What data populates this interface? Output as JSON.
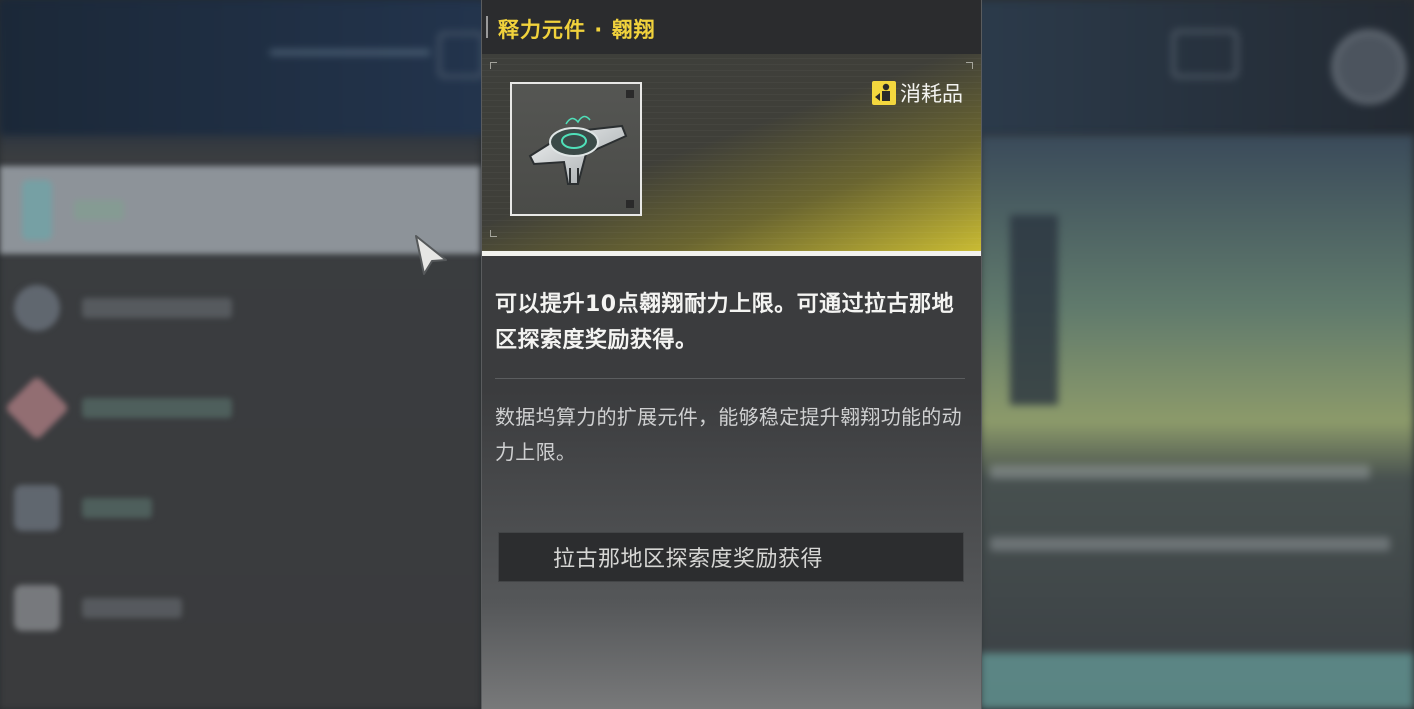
{
  "item": {
    "name": "释力元件 · 翱翔",
    "type_label": "消耗品",
    "type_icon": "consumable-icon",
    "description": "可以提升10点翱翔耐力上限。可通过拉古那地区探索度奖励获得。",
    "lore": "数据坞算力的扩展元件，能够稳定提升翱翔功能的动力上限。",
    "source": "拉古那地区探索度奖励获得"
  },
  "colors": {
    "title_yellow": "#f1d23c",
    "badge_yellow": "#f3d73e",
    "banner_glow": "#c9bb33"
  }
}
